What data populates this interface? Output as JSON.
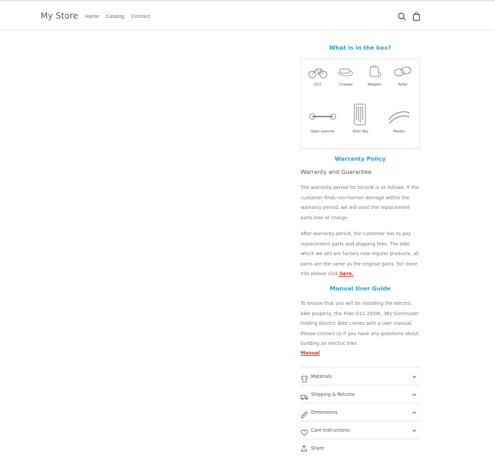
{
  "header": {
    "store_name": "My Store",
    "nav": [
      "Home",
      "Catalog",
      "Contact"
    ]
  },
  "box": {
    "heading": "What is in the box?",
    "items": [
      "D11",
      "Charger",
      "Adapter",
      "Pedal",
      "Open spanner",
      "Allen Key",
      "Fender"
    ]
  },
  "warranty": {
    "heading": "Warranty Policy",
    "subheading": "Warranty and Guarantee",
    "para1": "The warranty period for bicycle is as follows. If the customer finds non-human damage within the warranty period, we will send the replacement parts free of charge.",
    "para2": "After warranty period, the customer has to pay replacement parts and shipping fees. The bike which we sell are factory new regular products, all parts are the same as the original parts. For more info please click",
    "link": " here."
  },
  "manual": {
    "heading": "Manual User Guide",
    "para": "To ensure that you will be installing the electric bike properly, the Fiido D11 250W, 36V Commuter Folding Electric Bike comes with a user manual. Please contact us if you have any questions about building an electric bike.",
    "link": "Manual"
  },
  "accordion": [
    "Materials",
    "Shipping & Returns",
    "Dimensions",
    "Care Instructions"
  ],
  "share": "Share",
  "colors": {
    "accent_blue": "#1aa3df",
    "link_red": "#d9321c"
  },
  "icons": [
    "search-icon",
    "cart-icon",
    "shirt-icon",
    "truck-icon",
    "ruler-icon",
    "heart-icon",
    "chevron-down-icon",
    "share-icon"
  ]
}
